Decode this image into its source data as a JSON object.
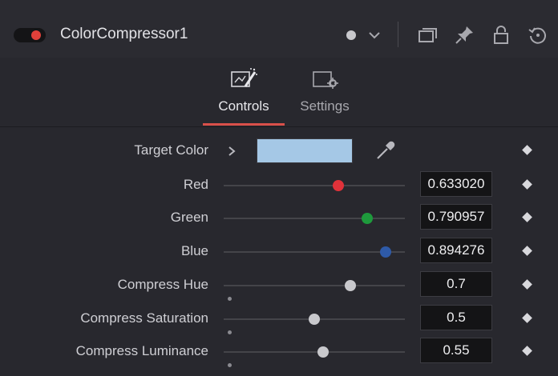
{
  "header": {
    "node_title": "ColorCompressor1",
    "toggle_color": "#e0403a",
    "icons": [
      "active-dot-icon",
      "chevron-down-icon",
      "versions-icon",
      "pin-icon",
      "lock-icon",
      "reset-icon"
    ]
  },
  "tabs": [
    {
      "label": "Controls",
      "icon": "controls-tab-icon",
      "active": true
    },
    {
      "label": "Settings",
      "icon": "settings-tab-icon",
      "active": false
    }
  ],
  "controls": {
    "target_color": {
      "label": "Target Color",
      "swatch_color": "#a5c8e6"
    },
    "red": {
      "label": "Red",
      "value": "0.633020",
      "level": 0.63302,
      "knob_color": "#e0323a"
    },
    "green": {
      "label": "Green",
      "value": "0.790957",
      "level": 0.790957,
      "knob_color": "#1e9a3c"
    },
    "blue": {
      "label": "Blue",
      "value": "0.894276",
      "level": 0.894276,
      "knob_color": "#2e5aa8"
    },
    "compress_hue": {
      "label": "Compress Hue",
      "value": "0.7",
      "level": 0.7,
      "default_level": 0.0,
      "knob_color": "#c8c8cc"
    },
    "compress_saturation": {
      "label": "Compress Saturation",
      "value": "0.5",
      "level": 0.5,
      "default_level": 0.0,
      "knob_color": "#c8c8cc"
    },
    "compress_luminance": {
      "label": "Compress Luminance",
      "value": "0.55",
      "level": 0.55,
      "default_level": 0.0,
      "knob_color": "#c8c8cc"
    }
  }
}
